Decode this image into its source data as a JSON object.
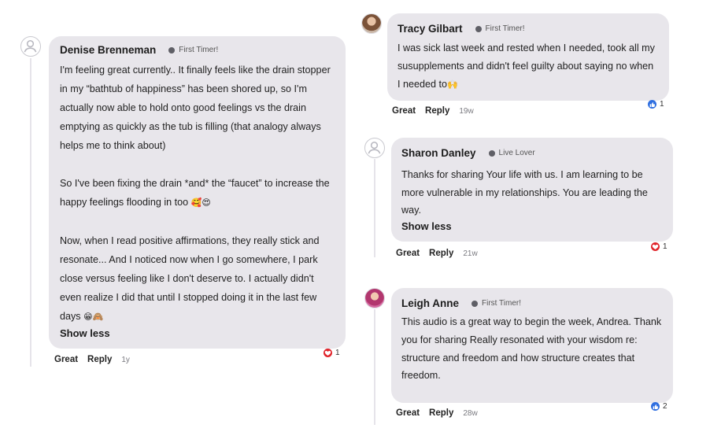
{
  "comments": {
    "denise": {
      "name": "Denise Brenneman",
      "badge": "First Timer!",
      "p1": "I'm feeling great currently.. It finally feels like the drain stopper in my “bathtub of happiness” has been shored up, so I'm actually now able to hold onto good feelings vs the drain emptying as quickly as the tub is filling (that analogy always helps me to think about)",
      "p2": "So I've been fixing the drain *and* the “faucet” to increase the happy feelings flooding in too",
      "p2_emoji": "🥰😍",
      "p3": "Now, when I read positive affirmations, they really stick and resonate... And I noticed now when I go somewhere, I park close versus feeling like I don't deserve to. I actually didn't even realize I did that until I stopped doing it in the last few days",
      "p3_emoji": "😁🙈",
      "show_less": "Show less",
      "great": "Great",
      "reply": "Reply",
      "time": "1y",
      "reaction_count": "1",
      "reaction_icon": "heart-icon"
    },
    "tracy": {
      "name": "Tracy Gilbart",
      "badge": "First Timer!",
      "text": "I was sick last week and rested when I needed, took all my susupplements and didn't feel guilty about saying no when I needed to",
      "emoji": "🙌",
      "great": "Great",
      "reply": "Reply",
      "time": "19w",
      "reaction_count": "1",
      "reaction_icon": "thumbs-up-icon"
    },
    "sharon": {
      "name": "Sharon Danley",
      "badge": "Live Lover",
      "text": "Thanks for sharing Your life with us. I am learning to be more vulnerable in my relationships. You are leading the way.",
      "show_less": "Show less",
      "great": "Great",
      "reply": "Reply",
      "time": "21w",
      "reaction_count": "1",
      "reaction_icon": "heart-icon"
    },
    "leigh": {
      "name": "Leigh Anne",
      "badge": "First Timer!",
      "text": "This audio is a great way to begin the week, Andrea. Thank you for sharing Really resonated with your wisdom re: structure and freedom and how structure creates that freedom.",
      "great": "Great",
      "reply": "Reply",
      "time": "28w",
      "reaction_count": "2",
      "reaction_icon": "thumbs-up-icon"
    }
  },
  "colors": {
    "bubble": "#e8e6eb",
    "heart": "#e0242b",
    "like": "#2f6fe0"
  }
}
